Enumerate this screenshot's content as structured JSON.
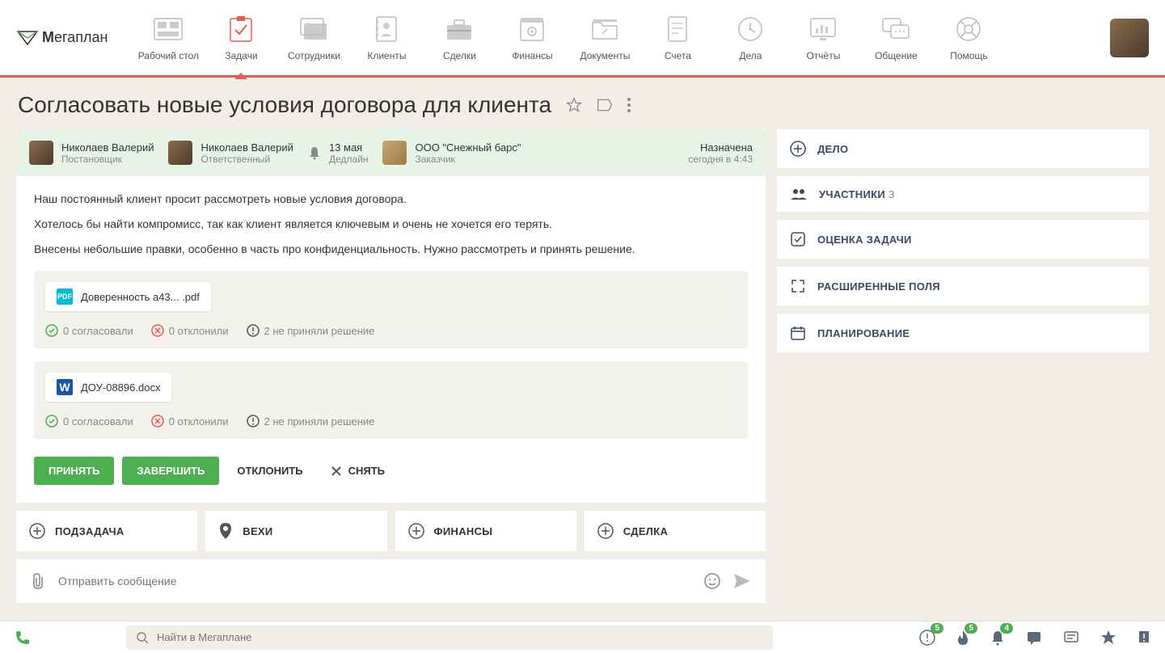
{
  "logo_text": "егаплан",
  "nav": [
    {
      "label": "Рабочий стол"
    },
    {
      "label": "Задачи"
    },
    {
      "label": "Сотрудники"
    },
    {
      "label": "Клиенты"
    },
    {
      "label": "Сделки"
    },
    {
      "label": "Финансы"
    },
    {
      "label": "Документы"
    },
    {
      "label": "Счета"
    },
    {
      "label": "Дела"
    },
    {
      "label": "Отчёты"
    },
    {
      "label": "Общение"
    },
    {
      "label": "Помощь"
    }
  ],
  "page_title": "Согласовать новые условия договора для клиента",
  "banner": {
    "creator_name": "Николаев Валерий",
    "creator_role": "Постановщик",
    "assignee_name": "Николаев Валерий",
    "assignee_role": "Ответственный",
    "deadline_date": "13 мая",
    "deadline_label": "Дедлайн",
    "client_name": "ООО \"Снежный барс\"",
    "client_role": "Заказчик",
    "status": "Назначена",
    "status_time": "сегодня в 4:43"
  },
  "description": {
    "p1": "Наш постоянный клиент просит рассмотреть новые условия договора.",
    "p2": "Хотелось бы найти компромисс, так как клиент является ключевым и очень не хочется его терять.",
    "p3": "Внесены небольшие правки, особенно в часть про конфиденциальность. Нужно рассмотреть и принять решение."
  },
  "files": [
    {
      "name": "Доверенность а43... .pdf",
      "icon_label": "PDF"
    },
    {
      "name": "ДОУ-08896.docx",
      "icon_label": "W"
    }
  ],
  "approval": {
    "approved": "0 согласовали",
    "rejected": "0 отклонили",
    "pending": "2 не приняли решение"
  },
  "actions": {
    "accept": "ПРИНЯТЬ",
    "complete": "ЗАВЕРШИТЬ",
    "decline": "ОТКЛОНИТЬ",
    "remove": "СНЯТЬ"
  },
  "quick": {
    "subtask": "ПОДЗАДАЧА",
    "milestones": "ВЕХИ",
    "finances": "ФИНАНСЫ",
    "deal": "СДЕЛКА"
  },
  "message_placeholder": "Отправить сообщение",
  "side": {
    "todo": "ДЕЛО",
    "participants": "УЧАСТНИКИ",
    "participants_count": "3",
    "rating": "ОЦЕНКА ЗАДАЧИ",
    "extended": "РАСШИРЕННЫЕ ПОЛЯ",
    "planning": "ПЛАНИРОВАНИЕ"
  },
  "search_placeholder": "Найти в Мегаплане",
  "badges": {
    "b1": "5",
    "b2": "5",
    "b3": "4"
  }
}
